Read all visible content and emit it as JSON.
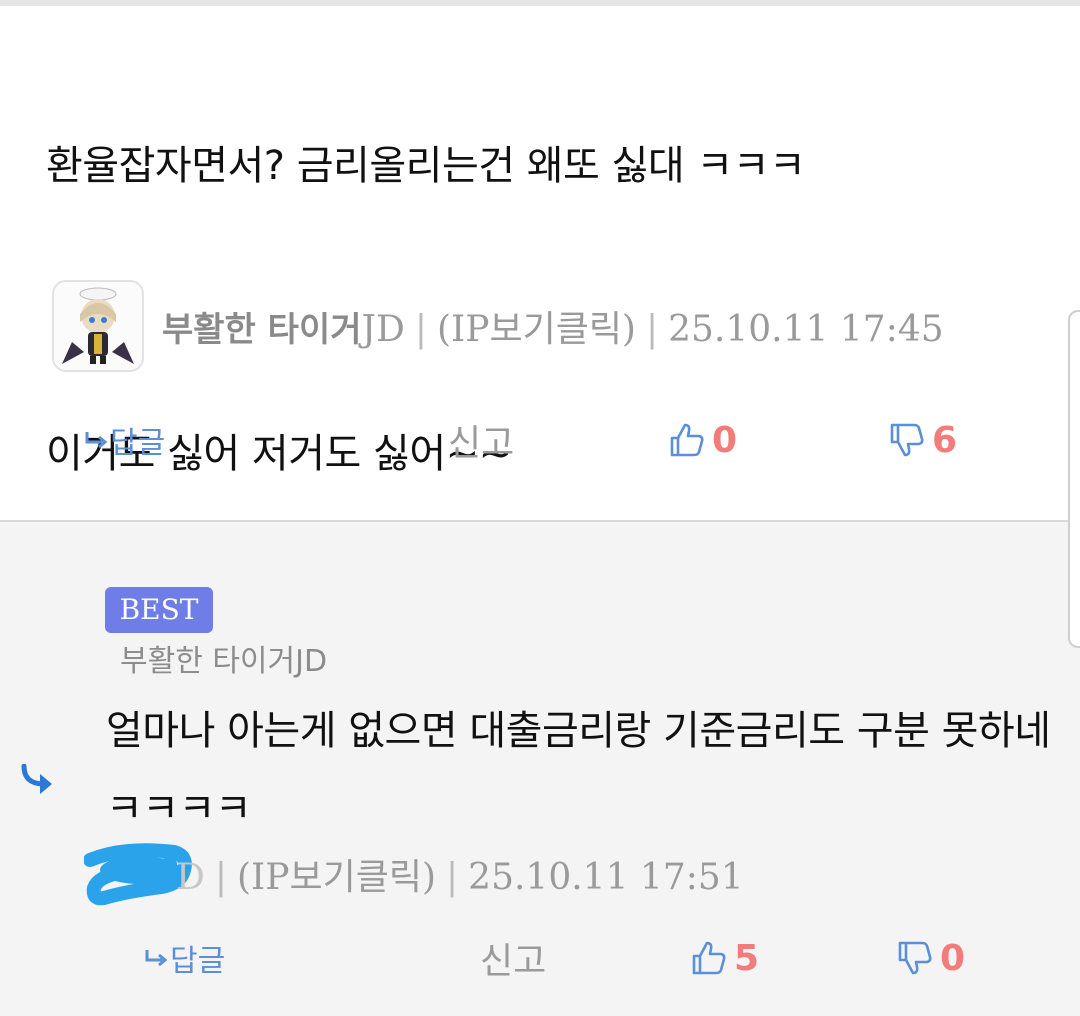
{
  "comments": [
    {
      "text_line1": "환율잡자면서? 금리올리는건 왜또 싫대 ㅋㅋㅋ",
      "text_line2": "이거도 싫어 저거도 싫어~~",
      "author_nick": "부활한 타이거",
      "author_suffix": "JD",
      "ip_link": "(IP보기클릭)",
      "timestamp": "25.10.11 17:45",
      "reply_label": "답글",
      "report_label": "신고",
      "likes": "0",
      "dislikes": "6"
    },
    {
      "badge": "BEST",
      "reply_to": "부활한 타이거JD",
      "text": "얼마나 아는게 없으면 대출금리랑 기준금리도 구분 못하네ㅋㅋㅋㅋ",
      "author_visible": "D",
      "ip_link": "(IP보기클릭)",
      "timestamp": "25.10.11 17:51",
      "reply_label": "답글",
      "report_label": "신고",
      "likes": "5",
      "dislikes": "0"
    }
  ],
  "colors": {
    "accent_blue": "#5b8fd6",
    "count_red": "#f27b7b",
    "best_badge": "#6e7ee6",
    "redaction": "#2aa3ea"
  },
  "icons": {
    "reply": "reply-arrow-icon",
    "like": "thumbs-up-icon",
    "dislike": "thumbs-down-icon",
    "avatar": "anime-character-avatar"
  }
}
